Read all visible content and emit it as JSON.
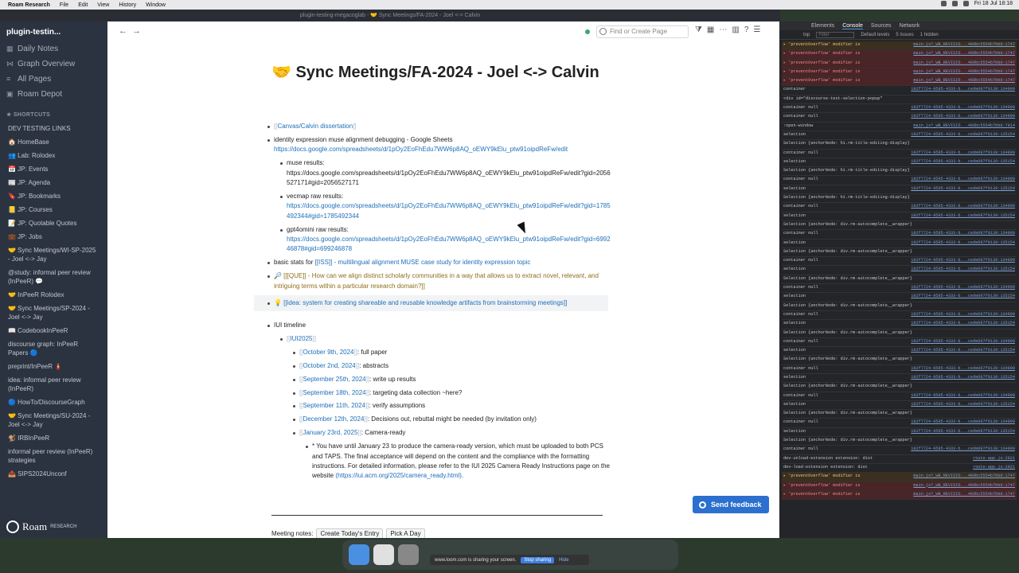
{
  "menubar": {
    "app": "Roam Research",
    "items": [
      "File",
      "Edit",
      "View",
      "History",
      "Window"
    ],
    "clock": "Fri 18 Jul 18:18"
  },
  "window_title": "plugin-testing-megacoglab - 🤝 Sync Meetings/FA-2024 - Joel <-> Calvin",
  "sidebar": {
    "graph_name": "plugin-testin...",
    "nav": [
      {
        "label": "Daily Notes",
        "icon": "calendar-icon"
      },
      {
        "label": "Graph Overview",
        "icon": "graph-icon"
      },
      {
        "label": "All Pages",
        "icon": "list-icon"
      },
      {
        "label": "Roam Depot",
        "icon": "box-icon"
      }
    ],
    "shortcuts_label": "SHORTCUTS",
    "shortcuts": [
      "DEV TESTING LINKS",
      "🏠 HomeBase",
      "👥 Lab: Rolodex",
      "📅 JP: Events",
      "📰 JP: Agenda",
      "🔖 JP: Bookmarks",
      "📒 JP: Courses",
      "📝 JP: Quotable Quotes",
      "💼 JP: Jobs",
      "🤝 Sync Meetings/WI-SP-2025 - Joel <-> Jay",
      "@study: informal peer review (InPeeR) 💬",
      "🤝 InPeeR Rolodex",
      "🤝 Sync Meetings/SP-2024 - Joel <-> Jay",
      "📖 CodebookInPeeR",
      "discourse graph: InPeeR Papers 🔵",
      "preprint/InPeeR 🧯",
      "idea: informal peer review (InPeeR)",
      "🔵 HowTo/DiscourseGraph",
      "🤝 Sync Meetings/SU-2024 - Joel <-> Jay",
      "🐒 IRBInPeeR",
      "informal peer review (InPeeR) strategies",
      "📤 SIPS2024Unconf"
    ],
    "logo": "Roam",
    "logo_sub": "RESEARCH"
  },
  "topbar": {
    "search_placeholder": "Find or Create Page"
  },
  "page": {
    "title": "🤝 Sync Meetings/FA-2024 - Joel <-> Calvin",
    "b1_link": "Canvas/Calvin dissertation",
    "b2_text": "identity expression muse alignment debugging - Google Sheets",
    "b2_url": "https://docs.google.com/spreadsheets/d/1pOy2EoFhEdu7WW6p8AQ_oEWY9kElu_ptw91oipdReFw/edit",
    "b3_label": "muse results:",
    "b3_url": "https://docs.google.com/spreadsheets/d/1pOy2EoFhEdu7WW6p8AQ_oEWY9kElu_ptw91oipdReFw/edit?gid=2056527171#gid=2056527171",
    "b4_label": "vecmap raw results:",
    "b4_url": "https://docs.google.com/spreadsheets/d/1pOy2EoFhEdu7WW6p8AQ_oEWY9kElu_ptw91oipdReFw/edit?gid=1785492344#gid=1785492344",
    "b5_label": "gpt4omini raw results:",
    "b5_url": "https://docs.google.com/spreadsheets/d/1pOy2EoFhEdu7WW6p8AQ_oEWY9kElu_ptw91oipdReFw/edit?gid=699246878#gid=699246878",
    "b6_prefix": "basic stats for",
    "b6_link": "[[ISS]] - multilingual alignment MUSE case study for identity expression topic",
    "b7_text": "🔎 [[[QUE]] - How can we align distinct scholarly communities in a way that allows us to extract novel, relevant, and intriguing terms within a particular research domain?]]",
    "b8_text": "💡 [[idea: system for creating shareable and reusable knowledge artifacts from brainstorming meetings]]",
    "b9_text": "IUI timeline",
    "b10_link": "IUI2025",
    "timeline": [
      {
        "date": "October 9th, 2024",
        "note": ": full paper"
      },
      {
        "date": "October 2nd, 2024",
        "note": ": abstracts"
      },
      {
        "date": "September 25th, 2024",
        "note": ": write up results"
      },
      {
        "date": "September 18th, 2024",
        "note": ": targeting data collection ~here?"
      },
      {
        "date": "September 11th, 2024",
        "note": ": verify assumptions"
      },
      {
        "date": "December 12th, 2024",
        "note": ": Decisions out, rebuttal might be needed (by invitation only)"
      },
      {
        "date": "January 23rd, 2025",
        "note": ": Camera-ready"
      }
    ],
    "camera_text": "* You have until January 23 to produce the camera-ready version, which must be uploaded to both PCS and TAPS. The final acceptance will depend on the content and the compliance with the formatting instructions. For detailed information, please refer to the IUI 2025 Camera Ready Instructions page on the website",
    "camera_url": "(https://iui.acm.org/2025/camera_ready.html).",
    "meeting_label": "Meeting notes:",
    "create_today": "Create Today's Entry",
    "pick_day": "Pick A Day"
  },
  "feedback_button": "Send feedback",
  "devtools": {
    "tabs": [
      "Elements",
      "Console",
      "Sources",
      "Network"
    ],
    "context": "top",
    "filter_placeholder": "Filter",
    "levels": "Default levels",
    "issues": "5 Issues",
    "hidden": "1 hidden",
    "log": [
      {
        "type": "warn",
        "text": "▸ 'preventOverflow' modifier is",
        "src": "main.js?_WB_REVISIO...460bc5554b7bb0:1747"
      },
      {
        "type": "err",
        "text": "▸ 'preventOverflow' modifier is",
        "src": "main.js?_WB_REVISIO...460bc5554b7bb0:1747"
      },
      {
        "type": "err",
        "text": "▸ 'preventOverflow' modifier is",
        "src": "main.js?_WB_REVISIO...460bc5554b7bb0:1747"
      },
      {
        "type": "err",
        "text": "▸ 'preventOverflow' modifier is",
        "src": "main.js?_WB_REVISIO...460bc5554b7bb0:1747"
      },
      {
        "type": "err",
        "text": "▸ 'preventOverflow' modifier is",
        "src": "main.js?_WB_REVISIO...460bc5554b7bb0:1747"
      },
      {
        "type": "log",
        "text": "container",
        "src": "192f7724-9595-4333-b...cede097f0139:134999"
      },
      {
        "type": "log",
        "text": "<div id=\"discourse-text-selection-popup\"",
        "src": ""
      },
      {
        "type": "log",
        "text": "container null",
        "src": "192f7724-9595-4333-b...cede097f0139:134999"
      },
      {
        "type": "log",
        "text": "container null",
        "src": "192f7724-9595-4333-b...cede097f0139:134999"
      },
      {
        "type": "log",
        "text": ":open-window",
        "src": "main.js?_WB_REVISIO...460bc5554b7bb0:7914"
      },
      {
        "type": "log",
        "text": "selection",
        "src": "192f7724-9595-4333-b...cede097f0139:135154"
      },
      {
        "type": "log",
        "text": "Selection {anchorNode: h1.rm-title-editing-display}",
        "src": ""
      },
      {
        "type": "log",
        "text": "container null",
        "src": "192f7724-9595-4333-b...cede097f0139:134999"
      },
      {
        "type": "log",
        "text": "selection",
        "src": "192f7724-9595-4333-b...cede097f0139:135154"
      },
      {
        "type": "log",
        "text": "Selection {anchorNode: h1.rm-title-editing-display}",
        "src": ""
      },
      {
        "type": "log",
        "text": "container null",
        "src": "192f7724-9595-4333-b...cede097f0139:134999"
      },
      {
        "type": "log",
        "text": "selection",
        "src": "192f7724-9595-4333-b...cede097f0139:135154"
      },
      {
        "type": "log",
        "text": "Selection {anchorNode: h1.rm-title-editing-display}",
        "src": ""
      },
      {
        "type": "log",
        "text": "container null",
        "src": "192f7724-9595-4333-b...cede097f0139:134999"
      },
      {
        "type": "log",
        "text": "selection",
        "src": "192f7724-9595-4333-b...cede097f0139:135154"
      },
      {
        "type": "log",
        "text": "Selection {anchorNode: div.rm-autocomplete__wrapper}",
        "src": ""
      },
      {
        "type": "log",
        "text": "container null",
        "src": "192f7724-9595-4333-b...cede097f0139:134999"
      },
      {
        "type": "log",
        "text": "selection",
        "src": "192f7724-9595-4333-b...cede097f0139:135154"
      },
      {
        "type": "log",
        "text": "Selection {anchorNode: div.rm-autocomplete__wrapper}",
        "src": ""
      },
      {
        "type": "log",
        "text": "container null",
        "src": "192f7724-9595-4333-b...cede097f0139:134999"
      },
      {
        "type": "log",
        "text": "selection",
        "src": "192f7724-9595-4333-b...cede097f0139:135154"
      },
      {
        "type": "log",
        "text": "Selection {anchorNode: div.rm-autocomplete__wrapper}",
        "src": ""
      },
      {
        "type": "log",
        "text": "container null",
        "src": "192f7724-9595-4333-b...cede097f0139:134999"
      },
      {
        "type": "log",
        "text": "selection",
        "src": "192f7724-9595-4333-b...cede097f0139:135154"
      },
      {
        "type": "log",
        "text": "Selection {anchorNode: div.rm-autocomplete__wrapper}",
        "src": ""
      },
      {
        "type": "log",
        "text": "container null",
        "src": "192f7724-9595-4333-b...cede097f0139:134999"
      },
      {
        "type": "log",
        "text": "selection",
        "src": "192f7724-9595-4333-b...cede097f0139:135154"
      },
      {
        "type": "log",
        "text": "Selection {anchorNode: div.rm-autocomplete__wrapper}",
        "src": ""
      },
      {
        "type": "log",
        "text": "container null",
        "src": "192f7724-9595-4333-b...cede097f0139:134999"
      },
      {
        "type": "log",
        "text": "selection",
        "src": "192f7724-9595-4333-b...cede097f0139:135154"
      },
      {
        "type": "log",
        "text": "Selection {anchorNode: div.rm-autocomplete__wrapper}",
        "src": ""
      },
      {
        "type": "log",
        "text": "container null",
        "src": "192f7724-9595-4333-b...cede097f0139:134999"
      },
      {
        "type": "log",
        "text": "selection",
        "src": "192f7724-9595-4333-b...cede097f0139:135154"
      },
      {
        "type": "log",
        "text": "Selection {anchorNode: div.rm-autocomplete__wrapper}",
        "src": ""
      },
      {
        "type": "log",
        "text": "container null",
        "src": "192f7724-9595-4333-b...cede097f0139:134999"
      },
      {
        "type": "log",
        "text": "selection",
        "src": "192f7724-9595-4333-b...cede097f0139:135154"
      },
      {
        "type": "log",
        "text": "Selection {anchorNode: div.rm-autocomplete__wrapper}",
        "src": ""
      },
      {
        "type": "log",
        "text": "container null",
        "src": "192f7724-9595-4333-b...cede097f0139:134999"
      },
      {
        "type": "log",
        "text": "selection",
        "src": "192f7724-9595-4333-b...cede097f0139:135154"
      },
      {
        "type": "log",
        "text": "Selection {anchorNode: div.rm-autocomplete__wrapper}",
        "src": ""
      },
      {
        "type": "log",
        "text": "container null",
        "src": "192f7724-9595-4333-b...cede097f0139:134999"
      },
      {
        "type": "log",
        "text": "dev-unload-extension extension: dist",
        "src": "route-app.js:2021"
      },
      {
        "type": "log",
        "text": "dev-load-extension extension: dist",
        "src": "route-app.js:2021"
      },
      {
        "type": "warn",
        "text": "▸ 'preventOverflow' modifier is",
        "src": "main.js?_WB_REVISIO...460bc5554b7bb0:1747"
      },
      {
        "type": "err",
        "text": "▸ 'preventOverflow' modifier is",
        "src": "main.js?_WB_REVISIO...460bc5554b7bb0:1747"
      },
      {
        "type": "err",
        "text": "▸ 'preventOverflow' modifier is",
        "src": "main.js?_WB_REVISIO...460bc5554b7bb0:1747"
      }
    ]
  },
  "share_bar": {
    "text": "www.loom.com is sharing your screen.",
    "stop": "Stop sharing",
    "hide": "Hide"
  }
}
